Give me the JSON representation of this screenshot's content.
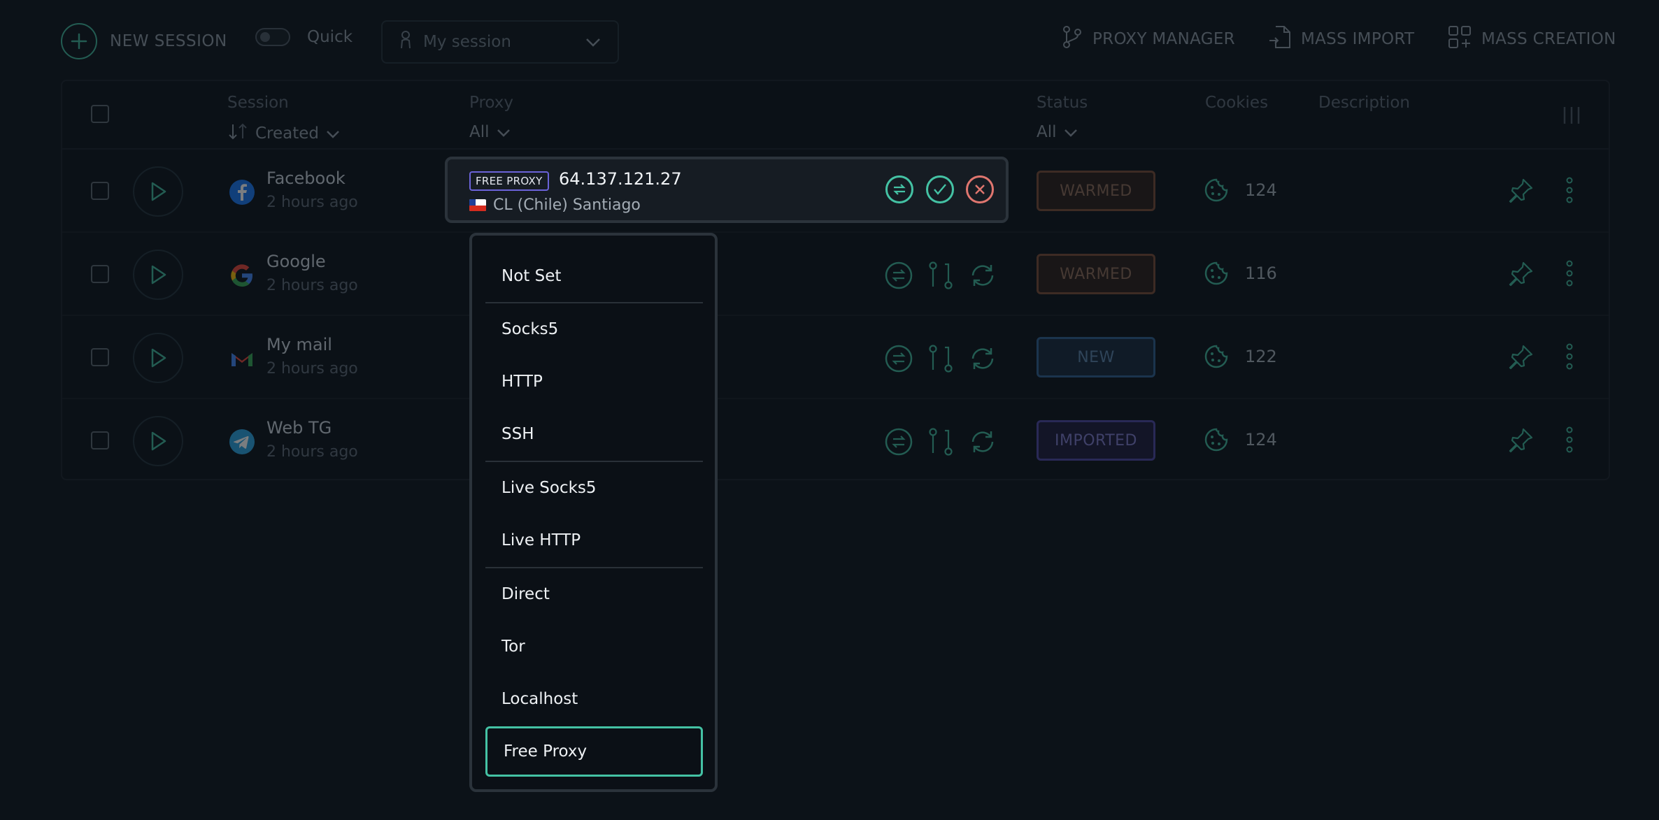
{
  "toolbar": {
    "new_session_label": "NEW SESSION",
    "quick_label": "Quick",
    "session_select_value": "My session",
    "proxy_manager_label": "PROXY MANAGER",
    "mass_import_label": "MASS IMPORT",
    "mass_creation_label": "MASS CREATION"
  },
  "table": {
    "headers": {
      "session": "Session",
      "session_sort": "Created",
      "proxy": "Proxy",
      "proxy_filter": "All",
      "status": "Status",
      "status_filter": "All",
      "cookies": "Cookies",
      "description": "Description"
    },
    "rows": [
      {
        "name": "Facebook",
        "time": "2 hours ago",
        "icon": "facebook-icon",
        "status": "WARMED",
        "cookies": "124"
      },
      {
        "name": "Google",
        "time": "2 hours ago",
        "icon": "google-icon",
        "status": "WARMED",
        "cookies": "116"
      },
      {
        "name": "My mail",
        "time": "2 hours ago",
        "icon": "gmail-icon",
        "status": "NEW",
        "cookies": "122"
      },
      {
        "name": "Web TG",
        "time": "2 hours ago",
        "icon": "telegram-icon",
        "status": "IMPORTED",
        "cookies": "124"
      }
    ]
  },
  "proxy_editor": {
    "tag": "FREE PROXY",
    "ip": "64.137.121.27",
    "location": "CL (Chile) Santiago"
  },
  "proxy_dropdown": {
    "options": [
      "Not Set",
      "Socks5",
      "HTTP",
      "SSH",
      "Live Socks5",
      "Live HTTP",
      "Direct",
      "Tor",
      "Localhost",
      "Free Proxy"
    ],
    "selected": "Free Proxy"
  },
  "colors": {
    "accent": "#44c2a4",
    "background": "#0c1218",
    "warmed": "#7a4a33",
    "new": "#2f5e8d",
    "imported": "#4c46a2",
    "cancel": "#e0766f"
  }
}
